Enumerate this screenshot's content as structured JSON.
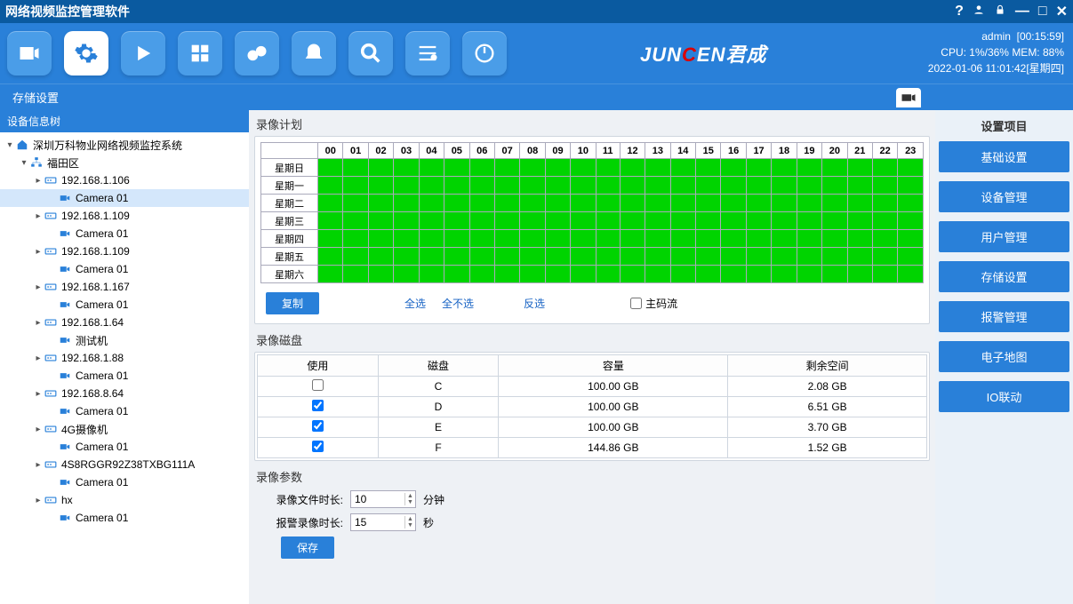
{
  "app": {
    "title": "网络视频监控管理软件"
  },
  "brand": {
    "left": "JUN",
    "mid": "C",
    "right": "EN君成"
  },
  "status": {
    "user": "admin",
    "uptime": "[00:15:59]",
    "cpu": "CPU:  1%/36%  MEM: 88%",
    "clock": "2022-01-06 11:01:42[星期四]"
  },
  "subheader": {
    "left": "存储设置"
  },
  "rightmenu": {
    "title": "设置项目",
    "items": [
      "基础设置",
      "设备管理",
      "用户管理",
      "存储设置",
      "报警管理",
      "电子地图",
      "IO联动"
    ]
  },
  "tree": {
    "title": "设备信息树",
    "nodes": [
      {
        "indent": 0,
        "caret": "▾",
        "icon": "home",
        "label": "深圳万科物业网络视频监控系统"
      },
      {
        "indent": 1,
        "caret": "▾",
        "icon": "net",
        "label": "福田区"
      },
      {
        "indent": 2,
        "caret": "▸",
        "icon": "dvr",
        "label": "192.168.1.106"
      },
      {
        "indent": 3,
        "caret": "",
        "icon": "cam",
        "label": "Camera 01",
        "selected": true
      },
      {
        "indent": 2,
        "caret": "▸",
        "icon": "dvr",
        "label": "192.168.1.109"
      },
      {
        "indent": 3,
        "caret": "",
        "icon": "cam",
        "label": "Camera 01"
      },
      {
        "indent": 2,
        "caret": "▸",
        "icon": "dvr",
        "label": "192.168.1.109"
      },
      {
        "indent": 3,
        "caret": "",
        "icon": "cam",
        "label": "Camera 01"
      },
      {
        "indent": 2,
        "caret": "▸",
        "icon": "dvr",
        "label": "192.168.1.167"
      },
      {
        "indent": 3,
        "caret": "",
        "icon": "cam",
        "label": "Camera 01"
      },
      {
        "indent": 2,
        "caret": "▸",
        "icon": "dvr",
        "label": "192.168.1.64"
      },
      {
        "indent": 3,
        "caret": "",
        "icon": "cam",
        "label": "测试机"
      },
      {
        "indent": 2,
        "caret": "▸",
        "icon": "dvr",
        "label": "192.168.1.88"
      },
      {
        "indent": 3,
        "caret": "",
        "icon": "cam",
        "label": "Camera 01"
      },
      {
        "indent": 2,
        "caret": "▸",
        "icon": "dvr",
        "label": "192.168.8.64"
      },
      {
        "indent": 3,
        "caret": "",
        "icon": "cam",
        "label": "Camera 01"
      },
      {
        "indent": 2,
        "caret": "▸",
        "icon": "dvr",
        "label": "4G摄像机"
      },
      {
        "indent": 3,
        "caret": "",
        "icon": "cam",
        "label": "Camera 01"
      },
      {
        "indent": 2,
        "caret": "▸",
        "icon": "dvr",
        "label": "4S8RGGR92Z38TXBG111A"
      },
      {
        "indent": 3,
        "caret": "",
        "icon": "cam",
        "label": "Camera 01"
      },
      {
        "indent": 2,
        "caret": "▸",
        "icon": "dvr",
        "label": "hx"
      },
      {
        "indent": 3,
        "caret": "",
        "icon": "cam",
        "label": "Camera 01"
      }
    ]
  },
  "schedule": {
    "title": "录像计划",
    "hours": [
      "00",
      "01",
      "02",
      "03",
      "04",
      "05",
      "06",
      "07",
      "08",
      "09",
      "10",
      "11",
      "12",
      "13",
      "14",
      "15",
      "16",
      "17",
      "18",
      "19",
      "20",
      "21",
      "22",
      "23"
    ],
    "days": [
      "星期日",
      "星期一",
      "星期二",
      "星期三",
      "星期四",
      "星期五",
      "星期六"
    ],
    "copy_btn": "复制",
    "select_all": "全选",
    "select_none": "全不选",
    "invert": "反选",
    "main_stream": "主码流"
  },
  "disks": {
    "title": "录像磁盘",
    "headers": [
      "使用",
      "磁盘",
      "容量",
      "剩余空间"
    ],
    "rows": [
      {
        "use": false,
        "disk": "C",
        "cap": "100.00 GB",
        "free": "2.08 GB"
      },
      {
        "use": true,
        "disk": "D",
        "cap": "100.00 GB",
        "free": "6.51 GB"
      },
      {
        "use": true,
        "disk": "E",
        "cap": "100.00 GB",
        "free": "3.70 GB"
      },
      {
        "use": true,
        "disk": "F",
        "cap": "144.86 GB",
        "free": "1.52 GB"
      }
    ]
  },
  "params": {
    "title": "录像参数",
    "file_len_label": "录像文件时长:",
    "file_len": "10",
    "file_len_unit": "分钟",
    "alarm_len_label": "报警录像时长:",
    "alarm_len": "15",
    "alarm_len_unit": "秒",
    "save": "保存"
  }
}
